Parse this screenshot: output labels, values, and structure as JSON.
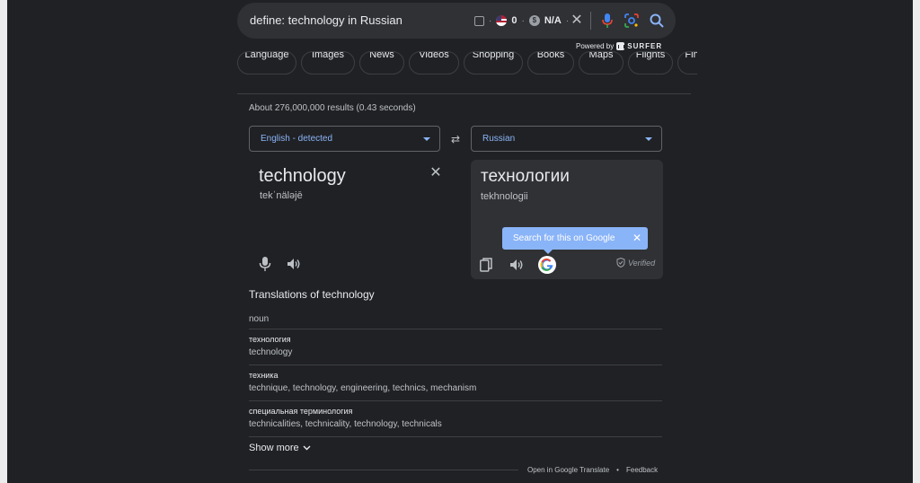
{
  "search": {
    "query": "define: technology in Russian",
    "ext_count": "0",
    "ext_value": "N/A",
    "powered_by": "Powered by",
    "powered_brand": "SURFER"
  },
  "chips": [
    "Language",
    "Images",
    "News",
    "Videos",
    "Shopping",
    "Books",
    "Maps",
    "Flights",
    "Finance"
  ],
  "stats": "About 276,000,000 results (0.43 seconds)",
  "translate": {
    "source_lang": "English - detected",
    "target_lang": "Russian",
    "source_word": "technology",
    "source_phonetic": "tekˈnäləjē",
    "target_word": "технологии",
    "target_translit": "tekhnologii",
    "tooltip": "Search for this on Google",
    "verified": "Verified"
  },
  "translations": {
    "title": "Translations of technology",
    "pos": "noun",
    "items": [
      {
        "word": "технология",
        "synonyms": "technology"
      },
      {
        "word": "техника",
        "synonyms": "technique, technology, engineering, technics, mechanism"
      },
      {
        "word": "специальная терминология",
        "synonyms": "technicalities, technicality, technology, technicals"
      }
    ],
    "show_more": "Show more"
  },
  "footer": {
    "open_in": "Open in Google Translate",
    "sep": "•",
    "feedback": "Feedback"
  },
  "colors": {
    "background": "#202124",
    "accent": "#8ab4f8"
  }
}
